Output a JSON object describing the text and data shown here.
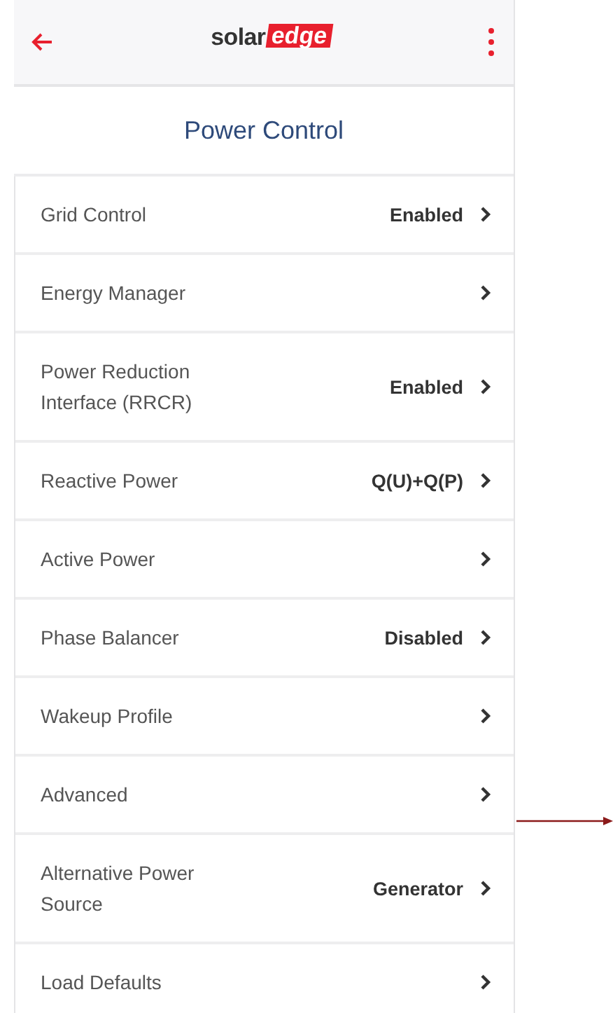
{
  "header": {
    "logo": {
      "text": "solar",
      "highlight": "edge"
    }
  },
  "page": {
    "title": "Power Control"
  },
  "items": [
    {
      "label": "Grid Control",
      "value": "Enabled"
    },
    {
      "label": "Energy Manager"
    },
    {
      "label": "Power Reduction Interface (RRCR)",
      "value": "Enabled"
    },
    {
      "label": "Reactive Power",
      "value": "Q(U)+Q(P)"
    },
    {
      "label": "Active Power"
    },
    {
      "label": "Phase Balancer",
      "value": "Disabled"
    },
    {
      "label": "Wakeup Profile"
    },
    {
      "label": "Advanced"
    },
    {
      "label": "Alternative Power Source",
      "value": "Generator"
    },
    {
      "label": "Load Defaults"
    }
  ]
}
